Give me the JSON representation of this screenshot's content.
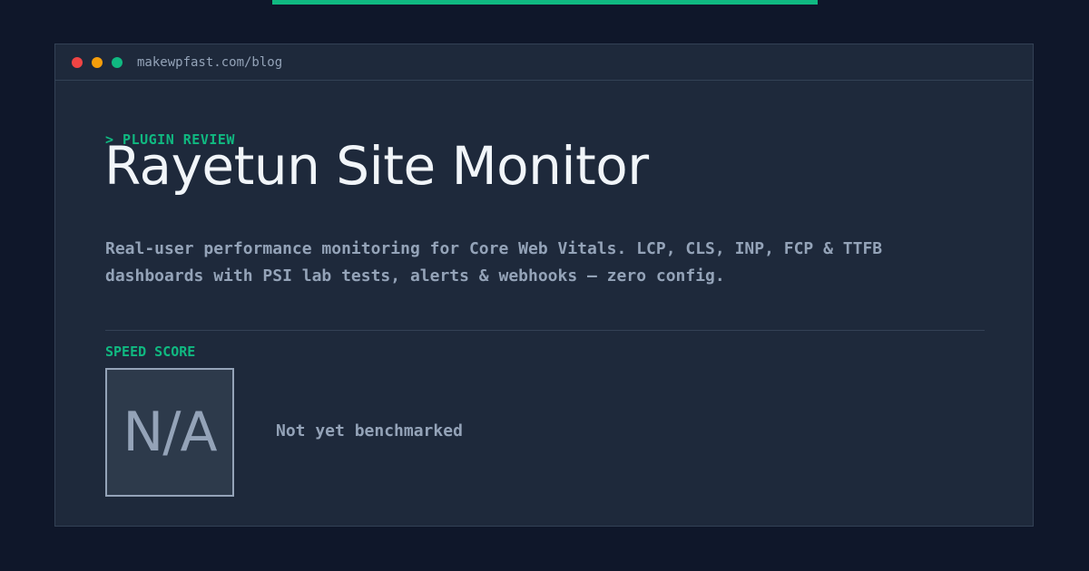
{
  "colors": {
    "background": "#0f172a",
    "card": "#1e293b",
    "accent": "#10b981",
    "muted_text": "#94a3b8",
    "title_text": "#f1f5f9",
    "dot_red": "#ef4444",
    "dot_yellow": "#f59e0b",
    "dot_green": "#10b981"
  },
  "window": {
    "url": "makewpfast.com/blog"
  },
  "header": {
    "kicker": "> PLUGIN REVIEW",
    "title": "Rayetun Site Monitor"
  },
  "description": {
    "line1": "Real-user performance monitoring for Core Web Vitals. LCP, CLS, INP, FCP & TTFB",
    "line2": "dashboards with PSI lab tests, alerts & webhooks — zero config."
  },
  "score": {
    "label": "SPEED SCORE",
    "value": "N/A",
    "status": "Not yet benchmarked"
  }
}
